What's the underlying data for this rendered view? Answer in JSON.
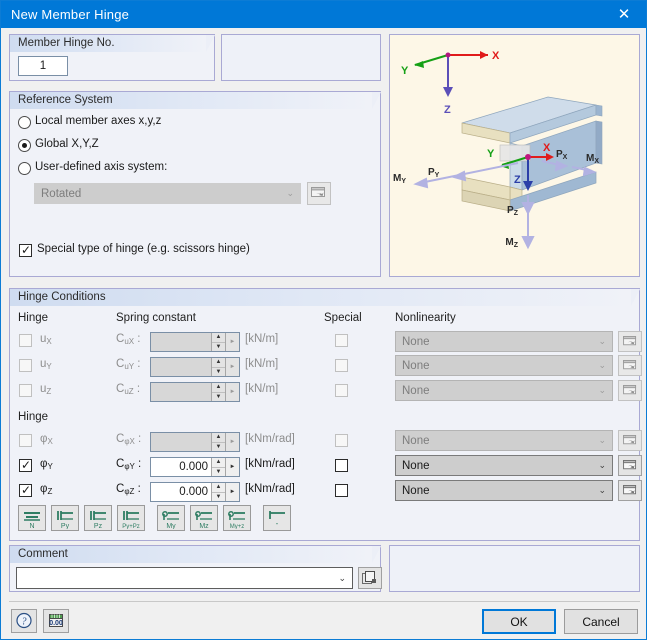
{
  "window": {
    "title": "New Member Hinge",
    "close_icon": "close-icon"
  },
  "member_hinge_no": {
    "legend": "Member Hinge No.",
    "value": "1"
  },
  "reference_system": {
    "legend": "Reference System",
    "options": [
      {
        "label": "Local member axes x,y,z",
        "selected": false
      },
      {
        "label": "Global X,Y,Z",
        "selected": true
      },
      {
        "label": "User-defined axis system:",
        "selected": false
      }
    ],
    "axis_combo": {
      "value": "Rotated",
      "enabled": false
    },
    "axis_edit_button": "edit-axis-system-button",
    "special_hinge": {
      "label": "Special type of hinge (e.g. scissors hinge)",
      "checked": true
    }
  },
  "hinge_conditions": {
    "legend": "Hinge Conditions",
    "columns": {
      "hinge": "Hinge",
      "spring_constant": "Spring constant",
      "special": "Special",
      "nonlinearity": "Nonlinearity"
    },
    "translation_header": "Hinge",
    "rotation_header": "Hinge",
    "rows": [
      {
        "dof": "u",
        "axis": "X",
        "checked": false,
        "enabled": false,
        "spring_symbol": "C",
        "spring_sub": "uX",
        "value": "",
        "unit": "[kN/m]",
        "special": false,
        "nonlinearity": "None"
      },
      {
        "dof": "u",
        "axis": "Y",
        "checked": false,
        "enabled": false,
        "spring_symbol": "C",
        "spring_sub": "uY",
        "value": "",
        "unit": "[kN/m]",
        "special": false,
        "nonlinearity": "None"
      },
      {
        "dof": "u",
        "axis": "Z",
        "checked": false,
        "enabled": false,
        "spring_symbol": "C",
        "spring_sub": "uZ",
        "value": "",
        "unit": "[kN/m]",
        "special": false,
        "nonlinearity": "None"
      },
      {
        "dof": "φ",
        "axis": "X",
        "checked": false,
        "enabled": false,
        "spring_symbol": "C",
        "spring_sub": "φX",
        "value": "",
        "unit": "[kNm/rad]",
        "special": false,
        "nonlinearity": "None"
      },
      {
        "dof": "φ",
        "axis": "Y",
        "checked": true,
        "enabled": true,
        "spring_symbol": "C",
        "spring_sub": "φY",
        "value": "0.000",
        "unit": "[kNm/rad]",
        "special": false,
        "nonlinearity": "None"
      },
      {
        "dof": "φ",
        "axis": "Z",
        "checked": true,
        "enabled": true,
        "spring_symbol": "C",
        "spring_sub": "φZ",
        "value": "0.000",
        "unit": "[kNm/rad]",
        "special": false,
        "nonlinearity": "None"
      }
    ],
    "presets": [
      {
        "name": "preset-n-button",
        "label": "N"
      },
      {
        "name": "preset-py-button",
        "label": "Py"
      },
      {
        "name": "preset-pz-button",
        "label": "Pz"
      },
      {
        "name": "preset-py-pz-button",
        "label": "Py+Pz"
      },
      {
        "name": "preset-my-button",
        "label": "My"
      },
      {
        "name": "preset-mz-button",
        "label": "Mz"
      },
      {
        "name": "preset-my-mz-button",
        "label": "My+z"
      },
      {
        "name": "preset-none-button",
        "label": "-"
      }
    ]
  },
  "comment": {
    "legend": "Comment",
    "value": "",
    "placeholder": "",
    "pick_button": "comment-pick-button"
  },
  "footer": {
    "help_button": "help-icon",
    "units_button": "units-icon",
    "ok": "OK",
    "cancel": "Cancel"
  },
  "graphic": {
    "name": "member-hinge-preview",
    "global_axes": [
      "X",
      "Y",
      "Z"
    ],
    "local_axes": [
      "X",
      "Y",
      "Z"
    ],
    "force_labels": [
      "PX",
      "PY",
      "PZ",
      "MX",
      "MY",
      "MZ"
    ],
    "colors": {
      "x_axis": "#e01b1b",
      "y_axis": "#15a015",
      "z_axis": "#4a40a8",
      "beam": "#a9c0d8",
      "background": "#fdf7e7"
    }
  },
  "colors": {
    "accent": "#0078d7",
    "group_border": "#a9a9d4",
    "panel_bg": "#f0f2f8"
  }
}
